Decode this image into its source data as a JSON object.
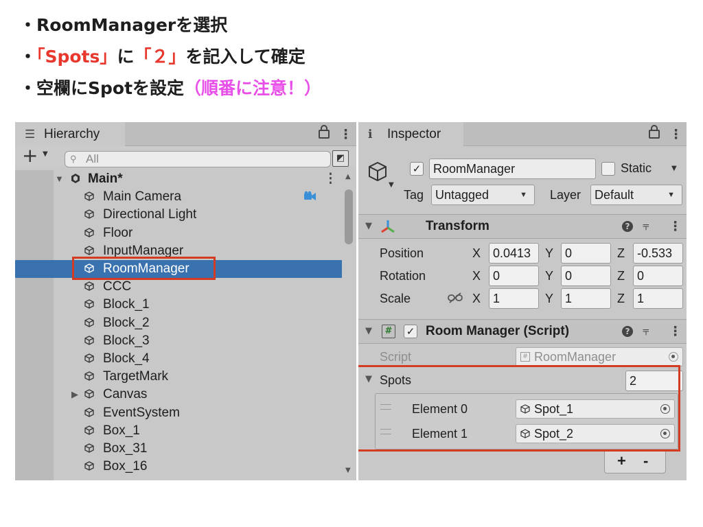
{
  "instructions": [
    {
      "prefix": "・",
      "segments": [
        {
          "text": "RoomManagerを選択",
          "color": "black"
        }
      ]
    },
    {
      "prefix": "・",
      "segments": [
        {
          "text": "「Spots」",
          "color": "red"
        },
        {
          "text": "に",
          "color": "black"
        },
        {
          "text": "「２」",
          "color": "red"
        },
        {
          "text": "を記入して確定",
          "color": "black"
        }
      ]
    },
    {
      "prefix": "・",
      "segments": [
        {
          "text": "空欄にSpotを設定",
          "color": "black"
        },
        {
          "text": "（順番に注意！）",
          "color": "pink"
        }
      ]
    }
  ],
  "hierarchy": {
    "tab_label": "Hierarchy",
    "search_placeholder": "All",
    "scene": "Main*",
    "items": [
      {
        "label": "Main Camera",
        "has_camera_gizmo": true
      },
      {
        "label": "Directional Light"
      },
      {
        "label": "Floor"
      },
      {
        "label": "InputManager"
      },
      {
        "label": "RoomManager",
        "selected": true
      },
      {
        "label": "CCC"
      },
      {
        "label": "Block_1"
      },
      {
        "label": "Block_2"
      },
      {
        "label": "Block_3"
      },
      {
        "label": "Block_4"
      },
      {
        "label": "TargetMark"
      },
      {
        "label": "Canvas",
        "collapsed_children": true
      },
      {
        "label": "EventSystem"
      },
      {
        "label": "Box_1"
      },
      {
        "label": "Box_31"
      },
      {
        "label": "Box_16"
      }
    ]
  },
  "inspector": {
    "tab_label": "Inspector",
    "object_name": "RoomManager",
    "active": true,
    "static_label": "Static",
    "static_checked": false,
    "tag_label": "Tag",
    "tag_value": "Untagged",
    "layer_label": "Layer",
    "layer_value": "Default",
    "transform": {
      "title": "Transform",
      "position_label": "Position",
      "rotation_label": "Rotation",
      "scale_label": "Scale",
      "position": {
        "x": "0.0413",
        "y": "0",
        "z": "-0.533"
      },
      "rotation": {
        "x": "0",
        "y": "0",
        "z": "0"
      },
      "scale": {
        "x": "1",
        "y": "1",
        "z": "1"
      }
    },
    "script_component": {
      "title": "Room Manager (Script)",
      "enabled": true,
      "script_label": "Script",
      "script_value": "RoomManager",
      "spots_label": "Spots",
      "spots_count": "2",
      "elements": [
        {
          "label": "Element 0",
          "value": "Spot_1"
        },
        {
          "label": "Element 1",
          "value": "Spot_2"
        }
      ],
      "add_label": "+",
      "remove_label": "-"
    }
  },
  "axis_labels": {
    "x": "X",
    "y": "Y",
    "z": "Z"
  },
  "colors": {
    "highlight": "#d33b22",
    "selected_row": "#3a72b0",
    "red_text": "#e8382e",
    "pink_text": "#e84fe8"
  }
}
